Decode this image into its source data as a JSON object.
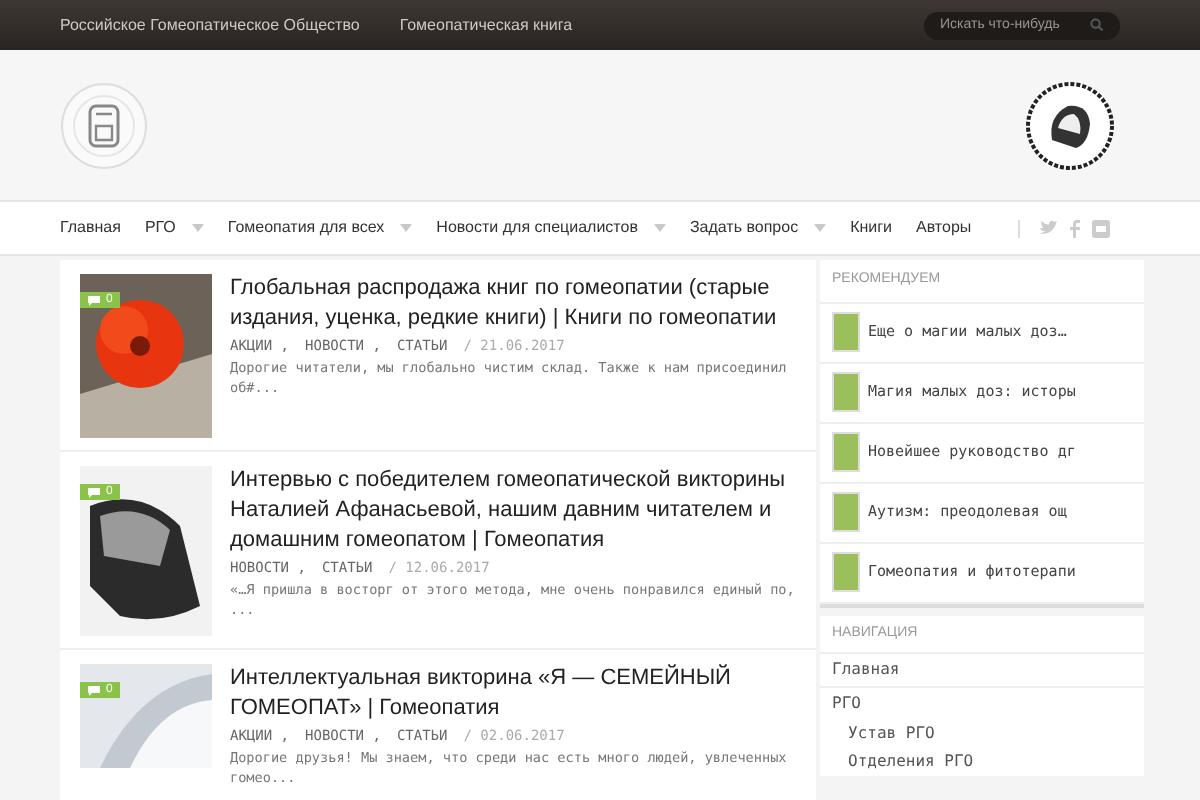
{
  "top_bar": {
    "links": [
      "Российское Гомеопатическое Общество",
      "Гомеопатическая книга"
    ],
    "search": {
      "placeholder": "Искать что-нибудь"
    }
  },
  "nav": {
    "items": [
      {
        "label": "Главная",
        "has_submenu": false
      },
      {
        "label": "РГО",
        "has_submenu": true
      },
      {
        "label": "Гомеопатия для всех",
        "has_submenu": true
      },
      {
        "label": "Новости для специалистов",
        "has_submenu": true
      },
      {
        "label": "Задать вопрос",
        "has_submenu": true
      },
      {
        "label": "Книги",
        "has_submenu": false
      },
      {
        "label": "Авторы",
        "has_submenu": false
      }
    ]
  },
  "posts": [
    {
      "comments": "0",
      "title": "Глобальная распродажа книг по гомеопатии (старые издания, уценка, редкие книги) | Книги по гомеопатии",
      "categories": [
        "АКЦИИ ,",
        "НОВОСТИ ,",
        "СТАТЬИ"
      ],
      "date": "/ 21.06.2017",
      "excerpt": [
        "Дорогие читатели, мы глобально чистим склад. Также к нам присоединил",
        "об#..."
      ]
    },
    {
      "comments": "0",
      "title": "Интервью с победителем гомеопатической викторины Наталией Афанасьевой, нашим давним читателем и домашним гомеопатом | Гомеопатия",
      "categories": [
        "НОВОСТИ ,",
        "СТАТЬИ"
      ],
      "date": "/ 12.06.2017",
      "excerpt": [
        "«…Я пришла в восторг от этого метода, мне очень понравился единый по,",
        "..."
      ]
    },
    {
      "comments": "0",
      "title": "Интеллектуальная викторина «Я — СЕМЕЙНЫЙ ГОМЕОПАТ» | Гомеопатия",
      "categories": [
        "АКЦИИ ,",
        "НОВОСТИ ,",
        "СТАТЬИ"
      ],
      "date": "/ 02.06.2017",
      "excerpt": [
        "Дорогие друзья! Мы знаем, что среди нас есть много людей, увлеченных",
        "гомео..."
      ]
    }
  ],
  "sidebar": {
    "recommend_title": "РЕКОМЕНДУЕМ",
    "recommend": [
      {
        "title": "Еще о магии малых доз…"
      },
      {
        "title": "Магия малых доз: исторы"
      },
      {
        "title": "Новейшее руководство дг"
      },
      {
        "title": "Аутизм: преодолевая ощ"
      },
      {
        "title": "Гомеопатия и фитотерапи"
      }
    ],
    "nav_title": "НАВИГАЦИЯ",
    "nav": [
      {
        "label": "Главная"
      },
      {
        "label": "РГО",
        "children": [
          {
            "label": "Устав РГО"
          },
          {
            "label": "Отделения РГО"
          }
        ]
      }
    ]
  }
}
